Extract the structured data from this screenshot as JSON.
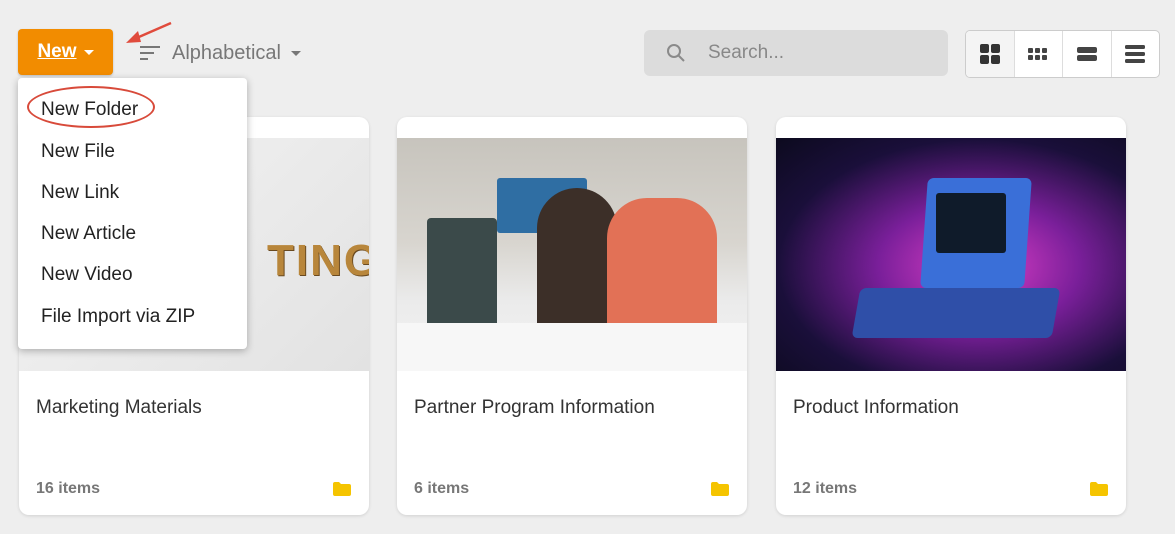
{
  "toolbar": {
    "new_label": "New",
    "sort_label": "Alphabetical",
    "search_placeholder": "Search...",
    "accent_color": "#f28c00",
    "view_modes": [
      "large-grid-icon",
      "small-grid-icon",
      "list-icon",
      "compact-list-icon"
    ]
  },
  "new_menu": {
    "items": [
      "New Folder",
      "New File",
      "New Link",
      "New Article",
      "New Video",
      "File Import via ZIP"
    ],
    "highlighted": "New Folder"
  },
  "cards": [
    {
      "title": "Marketing Materials",
      "count": "16 items",
      "image_text": "TING"
    },
    {
      "title": "Partner Program Information",
      "count": "6 items"
    },
    {
      "title": "Product Information",
      "count": "12 items"
    }
  ]
}
